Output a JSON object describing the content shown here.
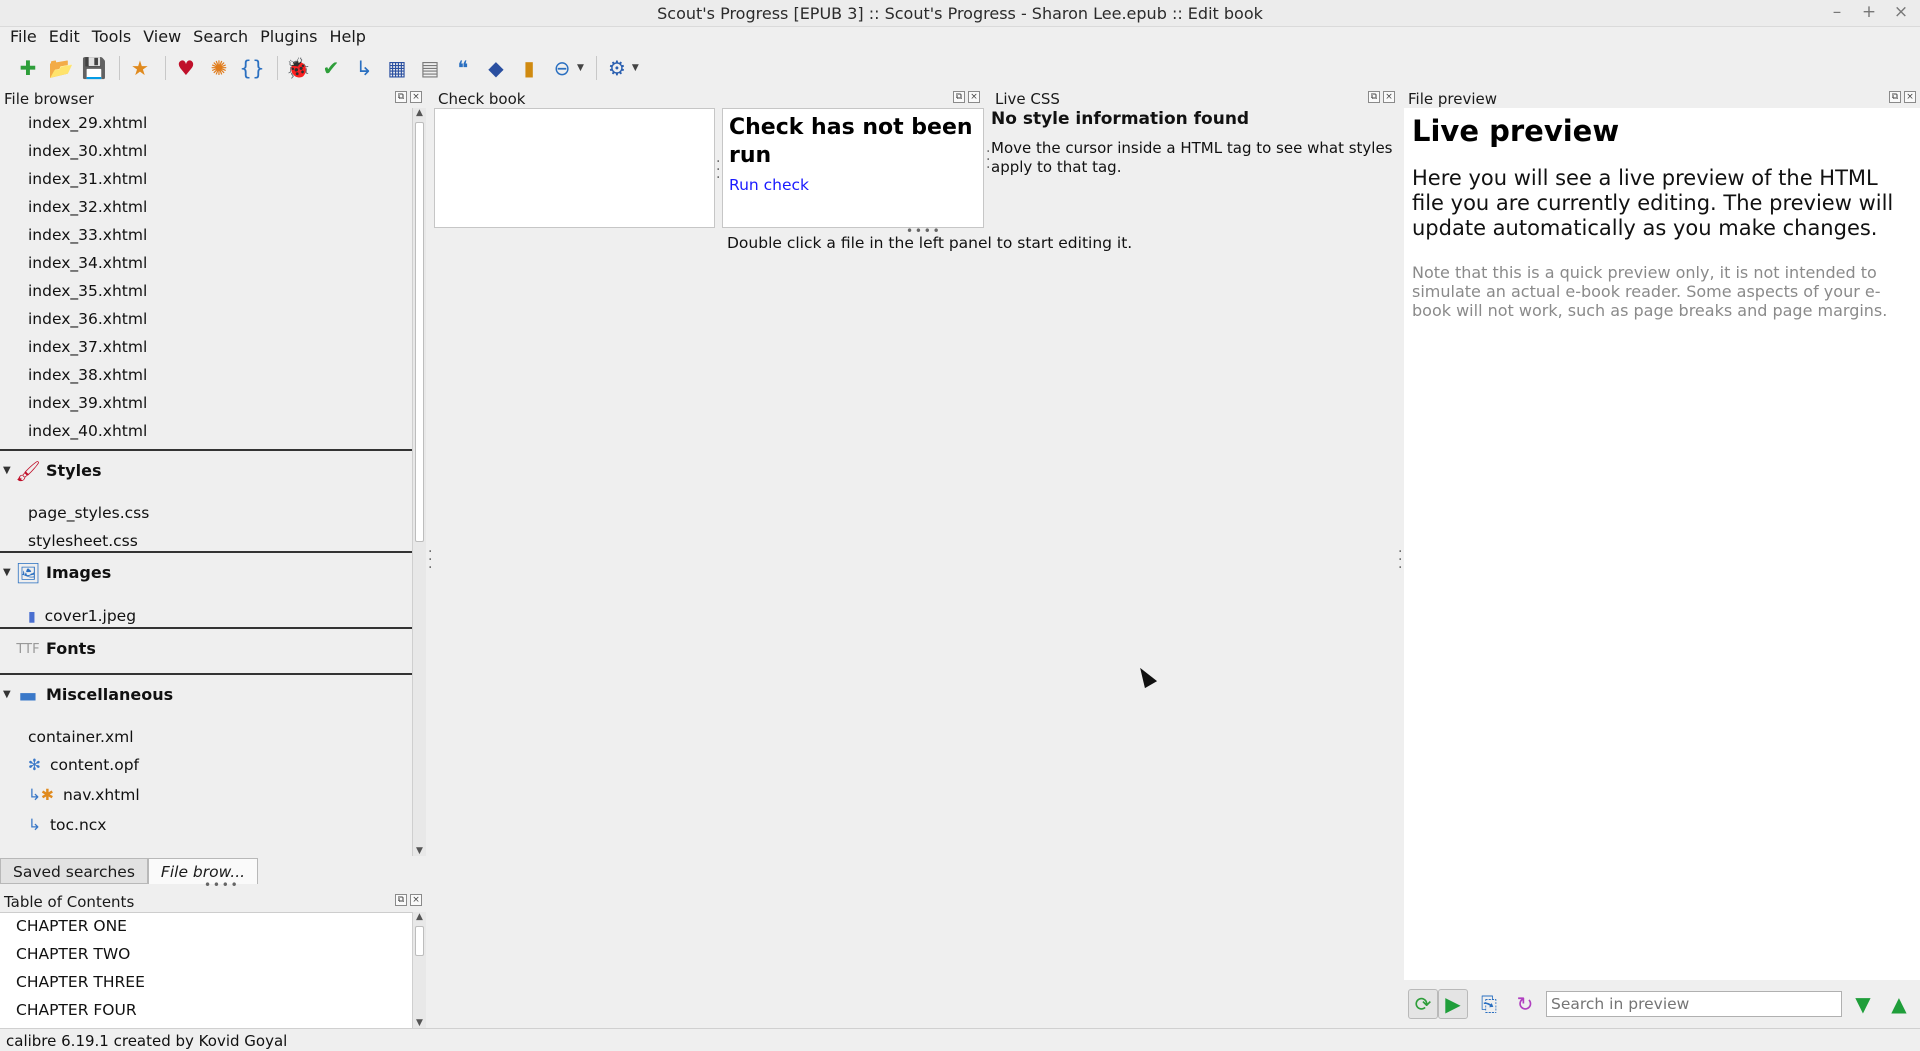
{
  "window": {
    "title": "Scout's Progress [EPUB 3] :: Scout's Progress - Sharon Lee.epub :: Edit book",
    "controls": [
      "–",
      "+",
      "×"
    ]
  },
  "menu": [
    "File",
    "Edit",
    "Tools",
    "View",
    "Search",
    "Plugins",
    "Help"
  ],
  "toolbar": [
    {
      "name": "new-file-icon",
      "glyph": "✚",
      "color": "#2e9e3a"
    },
    {
      "name": "open-book-icon",
      "glyph": "📂",
      "color": "#2a6fc0"
    },
    {
      "name": "save-icon",
      "glyph": "💾",
      "color": "#3f6fa8"
    },
    {
      "name": "sep"
    },
    {
      "name": "bookmark-star-icon",
      "glyph": "★",
      "color": "#e08a1e"
    },
    {
      "name": "sep"
    },
    {
      "name": "donate-heart-icon",
      "glyph": "♥",
      "color": "#c0102a"
    },
    {
      "name": "beautify-icon",
      "glyph": "✺",
      "color": "#e07b1a"
    },
    {
      "name": "code-braces-icon",
      "glyph": "{}",
      "color": "#2a6fc0"
    },
    {
      "name": "sep"
    },
    {
      "name": "check-book-bug-icon",
      "glyph": "🐞",
      "color": "#b83a00"
    },
    {
      "name": "spell-check-icon",
      "glyph": "✔",
      "color": "#2e9e3a"
    },
    {
      "name": "toc-icon",
      "glyph": "↳",
      "color": "#2a6fc0"
    },
    {
      "name": "reports-icon",
      "glyph": "▦",
      "color": "#2a4fa0"
    },
    {
      "name": "fonts-icon",
      "glyph": "▤",
      "color": "#7a7a7a"
    },
    {
      "name": "smarten-quotes-icon",
      "glyph": "❝",
      "color": "#2a6fc0"
    },
    {
      "name": "insert-tag-icon",
      "glyph": "◆",
      "color": "#2a4fa0"
    },
    {
      "name": "statistics-icon",
      "glyph": "▮",
      "color": "#d08a10"
    },
    {
      "name": "transform-icon",
      "glyph": "⊖",
      "color": "#2a6fc0",
      "dropdown": true
    },
    {
      "name": "sep"
    },
    {
      "name": "plugin-tools-icon",
      "glyph": "⚙",
      "color": "#2a5fb0",
      "dropdown": true
    }
  ],
  "file_browser": {
    "title": "File browser",
    "text_files": [
      "index_29.xhtml",
      "index_30.xhtml",
      "index_31.xhtml",
      "index_32.xhtml",
      "index_33.xhtml",
      "index_34.xhtml",
      "index_35.xhtml",
      "index_36.xhtml",
      "index_37.xhtml",
      "index_38.xhtml",
      "index_39.xhtml",
      "index_40.xhtml"
    ],
    "groups": {
      "styles": {
        "label": "Styles",
        "files": [
          "page_styles.css",
          "stylesheet.css"
        ]
      },
      "images": {
        "label": "Images",
        "files": [
          "cover1.jpeg"
        ]
      },
      "fonts": {
        "label": "Fonts"
      },
      "misc": {
        "label": "Miscellaneous",
        "files": [
          "container.xml",
          "content.opf",
          "nav.xhtml",
          "toc.ncx"
        ]
      }
    }
  },
  "tabs": {
    "saved_searches": "Saved searches",
    "file_browser": "File brow..."
  },
  "toc": {
    "title": "Table of Contents",
    "items": [
      "CHAPTER ONE",
      "CHAPTER TWO",
      "CHAPTER THREE",
      "CHAPTER FOUR"
    ]
  },
  "check_book": {
    "title": "Check book",
    "status": "Check has not been run",
    "run_link": "Run check"
  },
  "live_css": {
    "title": "Live CSS",
    "heading": "No style information found",
    "body": "Move the cursor inside a HTML tag to see what styles apply to that tag."
  },
  "editor": {
    "hint": "Double click a file in the left panel to start editing it."
  },
  "file_preview": {
    "title": "File preview",
    "heading": "Live preview",
    "lead": "Here you will see a live preview of the HTML file you are currently editing. The preview will update automatically as you make changes.",
    "note": "Note that this is a quick preview only, it is not intended to simulate an actual e-book reader. Some aspects of your e-book will not work, such as page breaks and page margins.",
    "search_placeholder": "Search in preview"
  },
  "status": "calibre 6.19.1 created by Kovid Goyal",
  "colors": {
    "link": "#1a1aff",
    "note": "#8a8a8a",
    "panel_bg": "#efefef"
  }
}
